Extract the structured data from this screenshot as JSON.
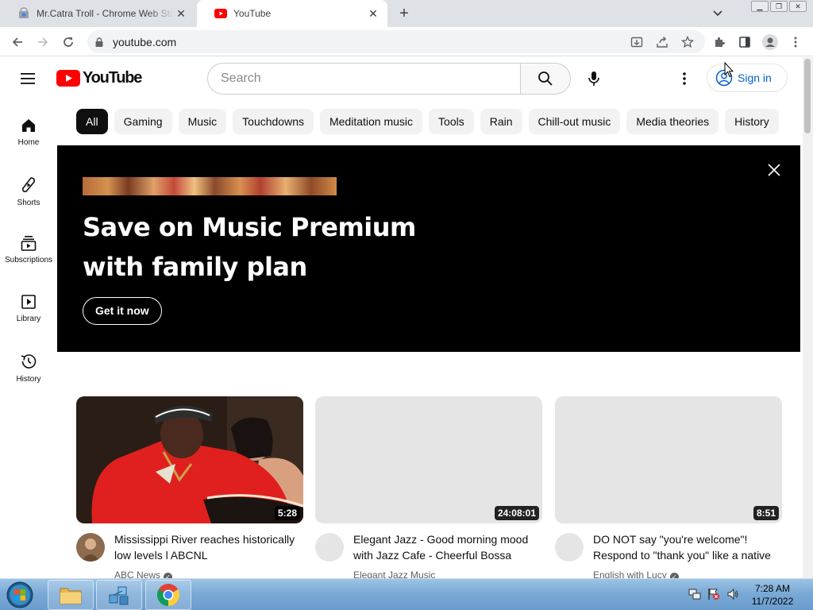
{
  "browser": {
    "tabs": [
      {
        "title": "Mr.Catra Troll - Chrome Web Store",
        "favicon": "chrome-web-store-icon",
        "active": false
      },
      {
        "title": "YouTube",
        "favicon": "youtube-icon",
        "active": true
      }
    ],
    "url": "youtube.com"
  },
  "header": {
    "logo_text": "YouTube",
    "search_placeholder": "Search",
    "sign_in_label": "Sign in"
  },
  "sidebar": {
    "items": [
      {
        "label": "Home",
        "icon": "home-icon"
      },
      {
        "label": "Shorts",
        "icon": "shorts-icon"
      },
      {
        "label": "Subscriptions",
        "icon": "subscriptions-icon"
      },
      {
        "label": "Library",
        "icon": "library-icon"
      },
      {
        "label": "History",
        "icon": "history-icon"
      }
    ]
  },
  "chips": [
    "All",
    "Gaming",
    "Music",
    "Touchdowns",
    "Meditation music",
    "Tools",
    "Rain",
    "Chill-out music",
    "Media theories",
    "History"
  ],
  "banner": {
    "headline_line1": "Save on Music Premium",
    "headline_line2": "with family plan",
    "cta_label": "Get it now"
  },
  "videos": [
    {
      "title": "Mississippi River reaches historically low levels l ABCNL",
      "channel": "ABC News",
      "duration": "5:28",
      "verified": true
    },
    {
      "title": "Elegant Jazz - Good morning mood with Jazz Cafe - Cheerful Bossa Nova Music",
      "channel": "Elegant Jazz Music",
      "duration": "24:08:01",
      "verified": false
    },
    {
      "title": "DO NOT say \"you're welcome\"! Respond to \"thank you\" like a native",
      "channel": "English with Lucy",
      "duration": "8:51",
      "verified": true
    }
  ],
  "taskbar": {
    "time": "7:28 AM",
    "date": "11/7/2022"
  },
  "colors": {
    "youtube_red": "#ff0000",
    "link_blue": "#065fd4",
    "chip_bg": "#f2f2f2",
    "chip_selected_bg": "#0f0f0f",
    "banner_bg": "#000000"
  }
}
